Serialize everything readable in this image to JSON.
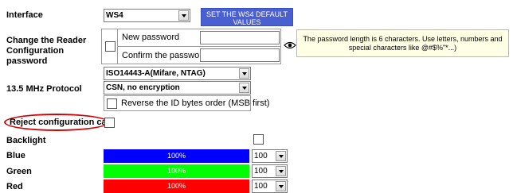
{
  "interface": {
    "label": "Interface",
    "selected": "WS4",
    "default_button": "SET THE WS4 DEFAULT VALUES"
  },
  "password": {
    "label": "Change the Reader Configuration password",
    "new_password_label": "New password",
    "confirm_password_label": "Confirm the password",
    "new_password_value": "",
    "confirm_password_value": "",
    "show_icon": "eye-icon",
    "hint": "The password length is 6 characters. Use letters, numbers and special characters like @#$%\"*...)"
  },
  "protocol": {
    "label": "13.5 MHz Protocol",
    "standard_selected": "ISO14443-A(Mifare, NTAG)",
    "encryption_selected": "CSN, no encryption",
    "reverse_label": "Reverse the ID bytes order (MSB first)",
    "reverse_checked": false
  },
  "reject": {
    "label": "Reject configuration card",
    "checked": false,
    "highlight_color": "#d40000"
  },
  "backlight": {
    "label": "Backlight",
    "checked": false,
    "channels": [
      {
        "name": "Blue",
        "level_text": "100%",
        "level": 100,
        "select": "100",
        "color": "#0000ff"
      },
      {
        "name": "Green",
        "level_text": "100%",
        "level": 100,
        "select": "100",
        "color": "#00ff00"
      },
      {
        "name": "Red",
        "level_text": "100%",
        "level": 100,
        "select": "100",
        "color": "#ff0000"
      }
    ]
  }
}
